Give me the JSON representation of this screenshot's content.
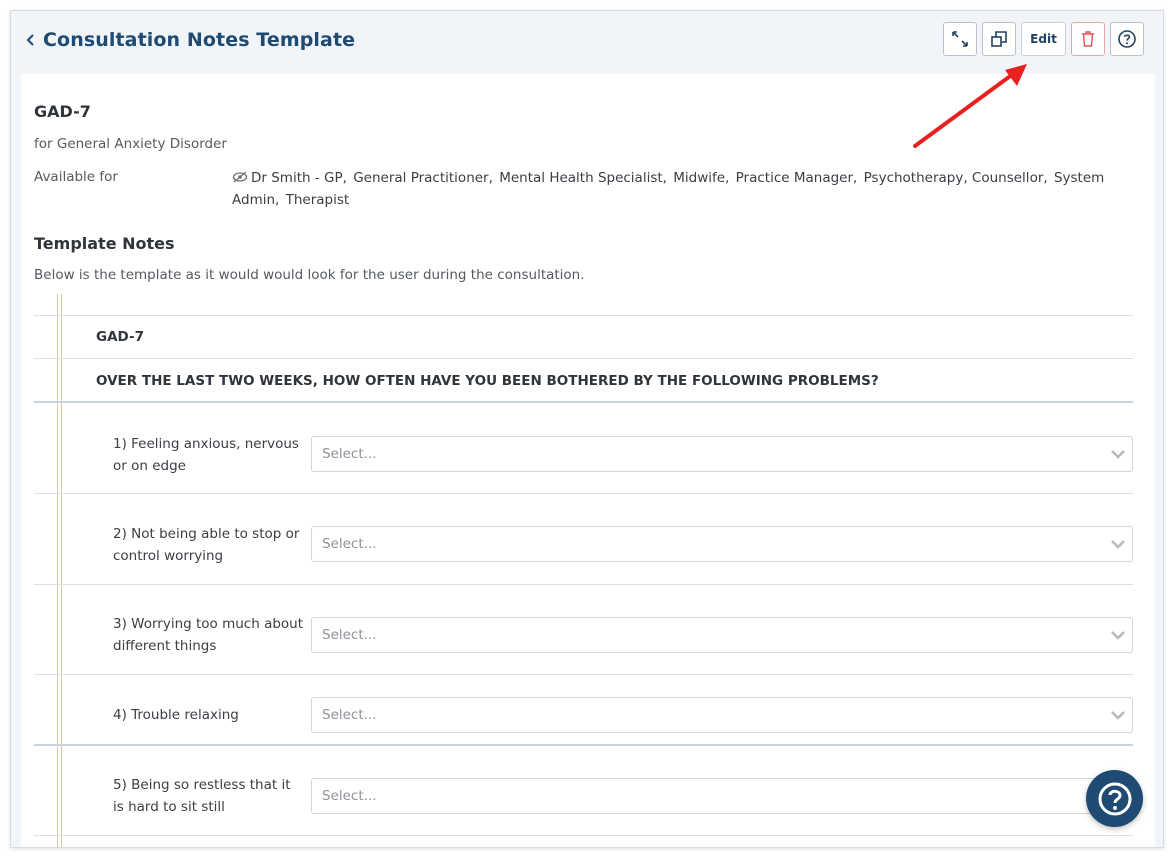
{
  "header": {
    "title": "Consultation Notes Template",
    "edit_label": "Edit",
    "icons": [
      "expand-icon",
      "duplicate-icon",
      "trash-icon",
      "help-circle-icon"
    ]
  },
  "template": {
    "name": "GAD-7",
    "subtitle": "for General Anxiety Disorder",
    "available_label": "Available for",
    "available_for": [
      "Dr Smith - GP,",
      "General Practitioner,",
      "Mental Health Specialist,",
      "Midwife,",
      "Practice Manager,",
      "Psychotherapy, Counsellor,",
      "System Admin,",
      "Therapist"
    ]
  },
  "notes": {
    "title": "Template Notes",
    "description": "Below is the template as it would would look for the user during the consultation.",
    "section_title": "GAD-7",
    "section_question": "OVER THE LAST TWO WEEKS, HOW OFTEN HAVE YOU BEEN BOTHERED BY THE FOLLOWING PROBLEMS?",
    "questions": [
      {
        "label": "1) Feeling anxious, nervous or on edge",
        "value": "Select..."
      },
      {
        "label": "2) Not being able to stop or control worrying",
        "value": "Select..."
      },
      {
        "label": "3) Worrying too much about different things",
        "value": "Select..."
      },
      {
        "label": "4) Trouble relaxing",
        "value": "Select..."
      },
      {
        "label": "5) Being so restless that it is hard to sit still",
        "value": "Select..."
      }
    ]
  },
  "colors": {
    "accent": "#1f4a72",
    "danger": "#e25555",
    "annotation_arrow": "#e8201e"
  }
}
